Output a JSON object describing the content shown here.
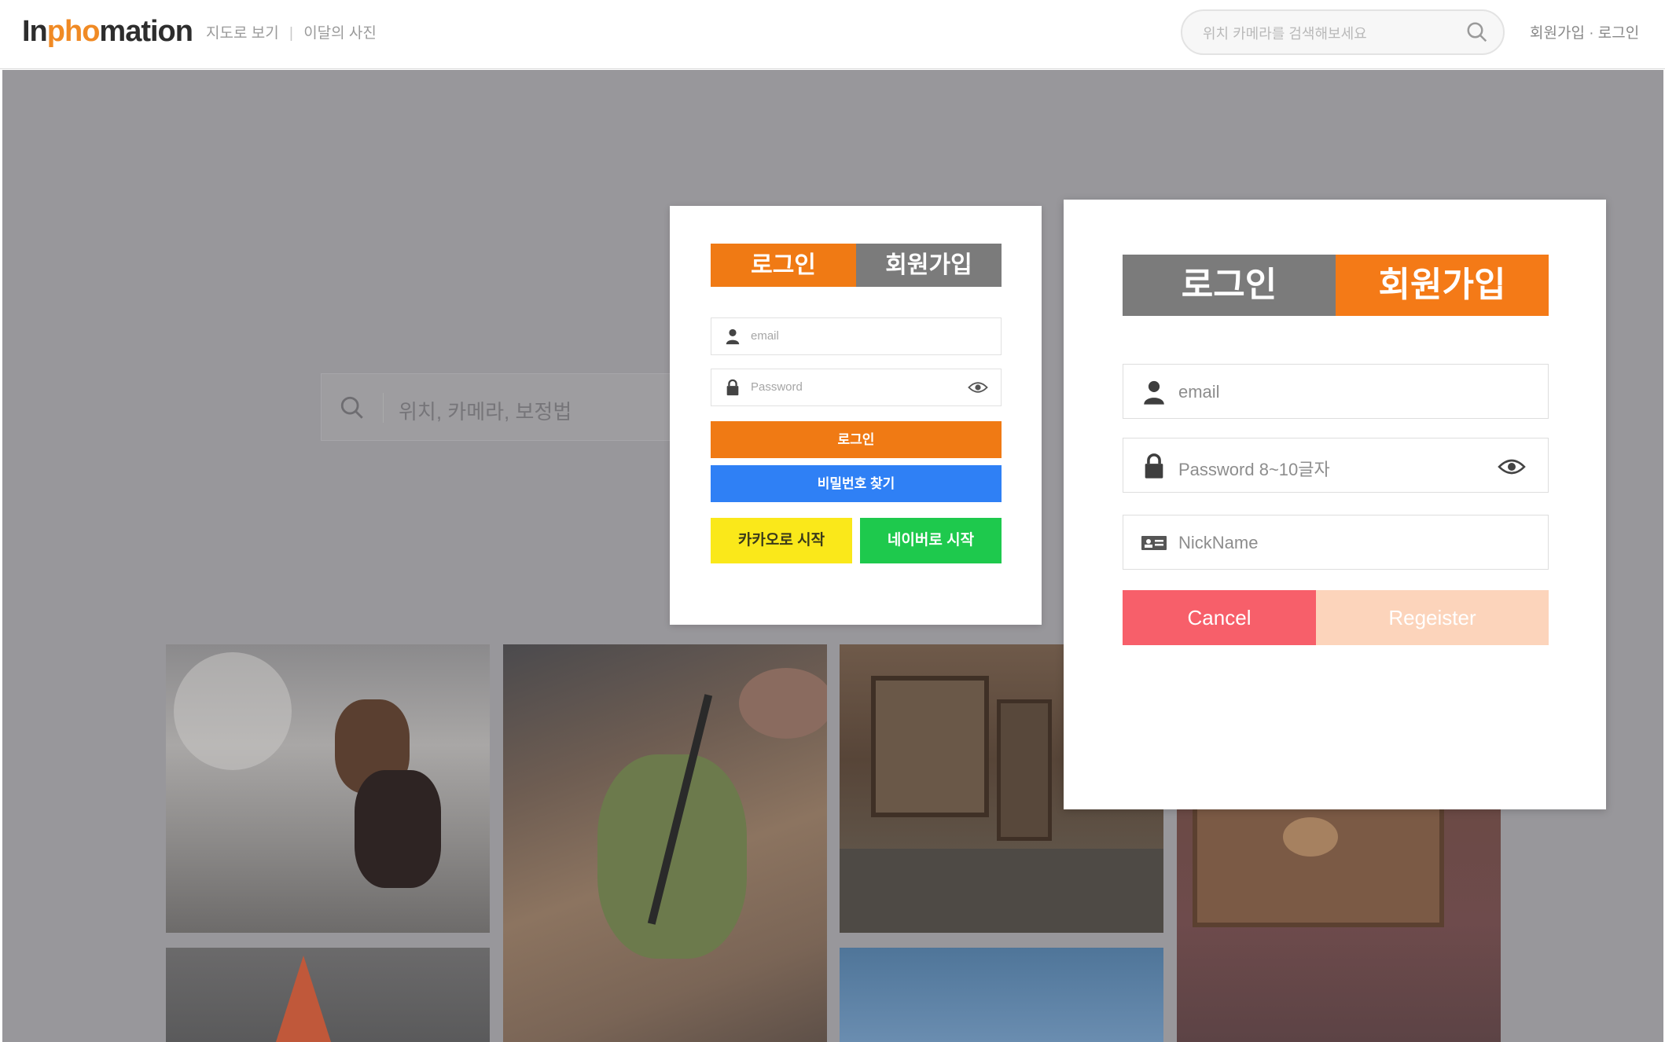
{
  "header": {
    "logo_prefix": "In",
    "logo_accent": "pho",
    "logo_suffix": "mation",
    "nav": [
      "지도로 보기",
      "이달의 사진"
    ],
    "nav_separator": "|",
    "search_placeholder": "위치 카메라를 검색해보세요",
    "auth_links": "회원가입 · 로그인"
  },
  "main": {
    "search_placeholder": "위치, 카메라, 보정법"
  },
  "login_modal": {
    "tabs": [
      "로그인",
      "회원가입"
    ],
    "active_tab": "로그인",
    "email_placeholder": "email",
    "password_placeholder": "Password",
    "login_button": "로그인",
    "find_password_button": "비밀번호 찾기",
    "kakao_button": "카카오로 시작",
    "naver_button": "네이버로 시작"
  },
  "register_modal": {
    "tabs": [
      "로그인",
      "회원가입"
    ],
    "active_tab": "회원가입",
    "email_placeholder": "email",
    "password_placeholder": "Password 8~10글자",
    "nickname_placeholder": "NickName",
    "cancel_button": "Cancel",
    "register_button": "Regeister"
  },
  "colors": {
    "brand_orange": "#f07a14",
    "tab_gray": "#7b7b7b",
    "blue": "#2f80f5",
    "kakao_yellow": "#fae81a",
    "naver_green": "#1ec94d",
    "cancel_red": "#f75f6a",
    "register_peach": "#fcd4bb",
    "overlay_gray": "#98979b"
  },
  "icons": {
    "header_search": "search-icon",
    "main_search": "search-icon",
    "email": "user-icon",
    "password": "lock-icon",
    "show_password": "eye-icon",
    "nickname": "id-card-icon"
  }
}
